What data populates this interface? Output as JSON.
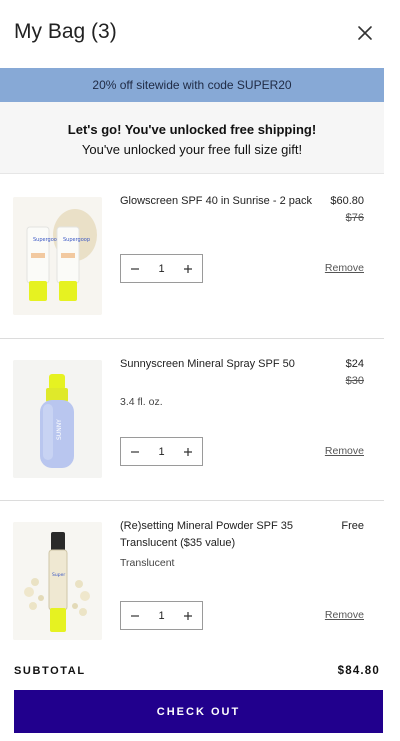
{
  "header": {
    "title": "My Bag (3)",
    "close_icon": "close-icon"
  },
  "promo_banner": {
    "text": "20% off sitewide with code SUPER20",
    "background": "#87a9d6"
  },
  "shipping_notice": {
    "line1": "Let's go! You've unlocked free shipping!",
    "line2": "You've unlocked your free full size gift!"
  },
  "items": [
    {
      "name": "Glowscreen SPF 40 in Sunrise - 2 pack",
      "variant": "",
      "price": "$60.80",
      "original_price": "$76",
      "quantity": "1",
      "remove_label": "Remove",
      "image_icon": "glowscreen-product-image"
    },
    {
      "name": "Sunnyscreen Mineral Spray SPF 50",
      "variant": "3.4 fl. oz.",
      "price": "$24",
      "original_price": "$30",
      "quantity": "1",
      "remove_label": "Remove",
      "image_icon": "sunnyscreen-spray-product-image"
    },
    {
      "name": "(Re)setting Mineral Powder SPF 35 Translucent ($35 value)",
      "variant": "Translucent",
      "price": "Free",
      "original_price": "",
      "quantity": "1",
      "remove_label": "Remove",
      "image_icon": "mineral-powder-product-image"
    }
  ],
  "quantity_controls": {
    "decrease_icon": "minus-icon",
    "increase_icon": "plus-icon"
  },
  "summary": {
    "subtotal_label": "SUBTOTAL",
    "subtotal_value": "$84.80"
  },
  "checkout": {
    "label": "CHECK OUT",
    "color": "#21008d"
  }
}
